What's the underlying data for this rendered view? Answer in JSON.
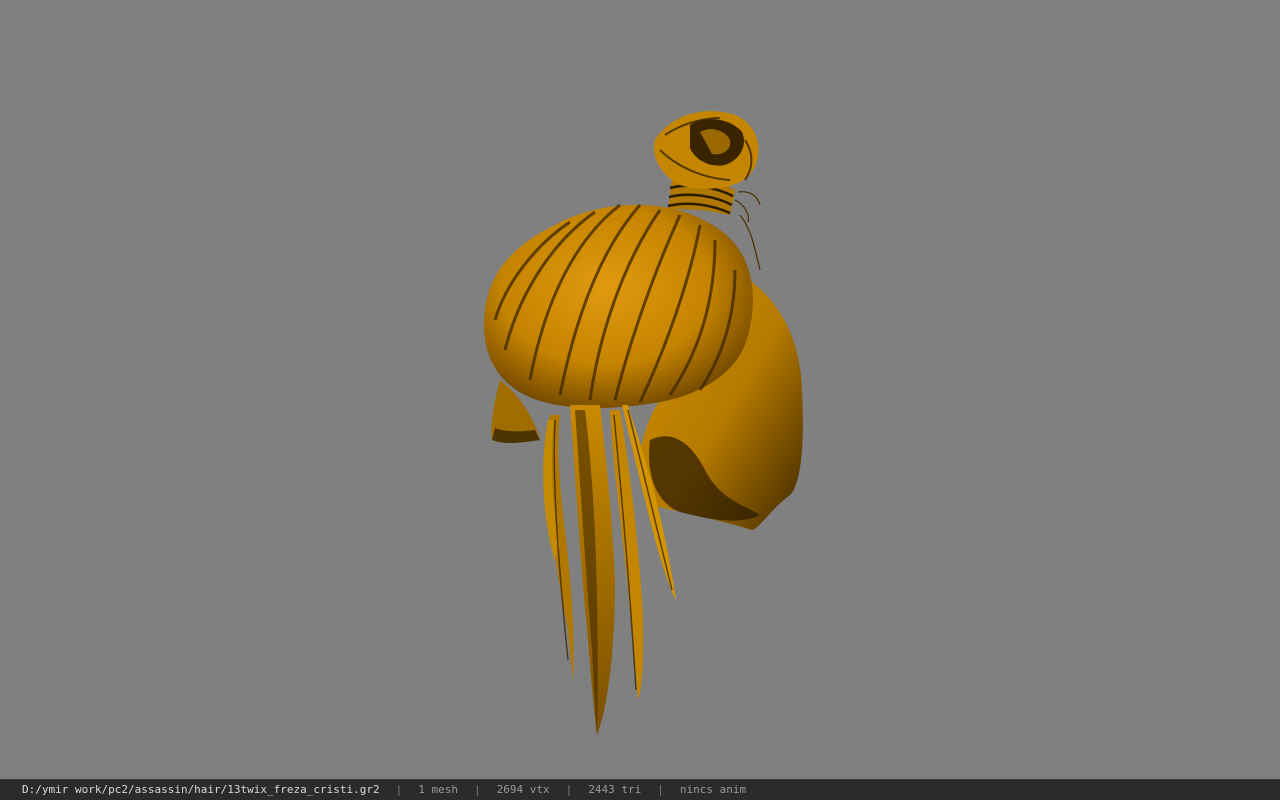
{
  "viewport": {
    "background": "#808080",
    "model": {
      "description_icon": "hair-mesh",
      "base_color": "#c98a00",
      "dark_color": "#4a2f00"
    }
  },
  "statusbar": {
    "path": "D:/ymir work/pc2/assassin/hair/13twix_freza_cristi.gr2",
    "mesh": "1 mesh",
    "vtx": "2694 vtx",
    "tri": "2443 tri",
    "anim": "nincs anim",
    "separator": "|"
  }
}
